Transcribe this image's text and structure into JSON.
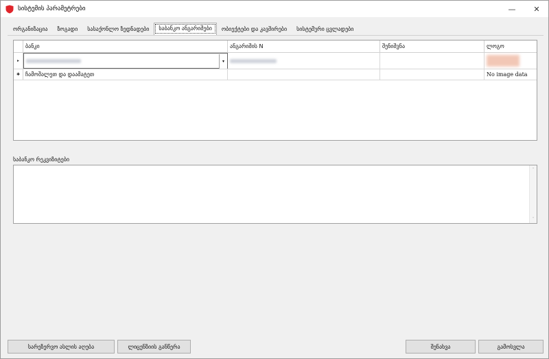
{
  "window": {
    "title": "სისტემის პარამეტრები",
    "minimize_glyph": "—",
    "close_glyph": "✕",
    "accent_color": "#e0252b"
  },
  "tabs": [
    {
      "label": "ორგანიზაცია",
      "active": false
    },
    {
      "label": "ზოგადი",
      "active": false
    },
    {
      "label": "სასაქონლო ზედნადები",
      "active": false
    },
    {
      "label": "საბანკო ანგარიშები",
      "active": true
    },
    {
      "label": "ობიექტები და კავშირები",
      "active": false
    },
    {
      "label": "სისტემური ცვლადები",
      "active": false
    }
  ],
  "grid": {
    "columns": [
      "ბანკი",
      "ანგარიშის N",
      "შენიშვნა",
      "ლოგო"
    ],
    "rows": [
      {
        "indicator": "▸",
        "bank": "",
        "account": "",
        "note": "",
        "logo": ""
      },
      {
        "indicator": "✱",
        "bank": "ჩამოშალეთ და დაამატეთ",
        "account": "",
        "note": "",
        "logo": "No image data"
      }
    ],
    "combo_glyph": "▾"
  },
  "requisites": {
    "label": "საბანკო რეკვიზიტები",
    "value": "",
    "scroll_up": "˄",
    "scroll_down": "˅"
  },
  "buttons": {
    "reset_password": "სარეზერვო ასლის აღება",
    "license_update": "ლიცენზიის განწერა",
    "save": "შენახვა",
    "exit": "გამოსვლა"
  }
}
